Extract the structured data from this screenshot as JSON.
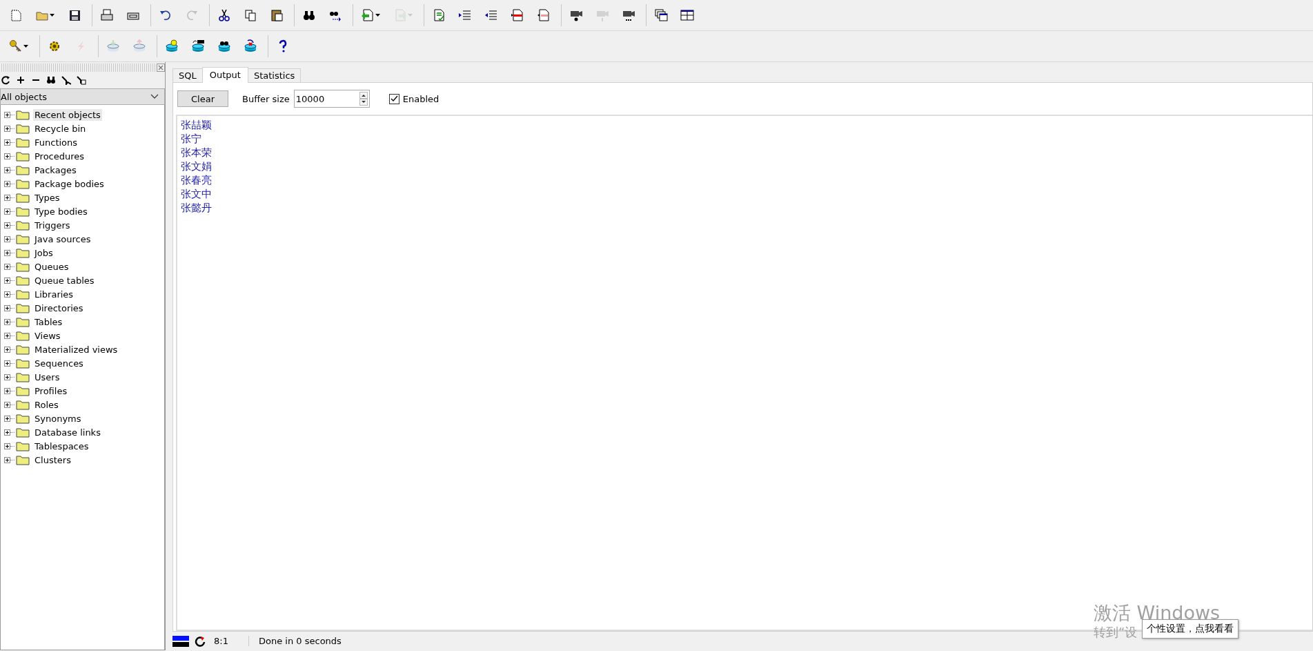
{
  "toolbars": [
    [
      [
        {
          "disabled": false,
          "dropdown": false
        },
        {
          "disabled": false,
          "dropdown": true
        },
        {
          "disabled": false,
          "dropdown": false
        }
      ],
      [
        {
          "disabled": false,
          "dropdown": false
        },
        {
          "disabled": false,
          "dropdown": false
        }
      ],
      [
        {
          "disabled": false,
          "dropdown": false
        },
        {
          "disabled": true,
          "dropdown": false
        }
      ],
      [
        {
          "disabled": false,
          "dropdown": false
        },
        {
          "disabled": false,
          "dropdown": false
        },
        {
          "disabled": false,
          "dropdown": false
        }
      ],
      [
        {
          "disabled": false,
          "dropdown": false
        },
        {
          "disabled": false,
          "dropdown": false
        }
      ],
      [
        {
          "disabled": false,
          "dropdown": true
        },
        {
          "disabled": true,
          "dropdown": true
        }
      ],
      [
        {
          "disabled": false,
          "dropdown": false
        },
        {
          "disabled": false,
          "dropdown": false
        },
        {
          "disabled": false,
          "dropdown": false
        },
        {
          "disabled": false,
          "dropdown": false
        },
        {
          "disabled": false,
          "dropdown": false
        }
      ],
      [
        {
          "disabled": false,
          "dropdown": false
        },
        {
          "disabled": true,
          "dropdown": false
        },
        {
          "disabled": false,
          "dropdown": false
        }
      ],
      [
        {
          "disabled": false,
          "dropdown": false
        },
        {
          "disabled": false,
          "dropdown": false
        }
      ]
    ],
    [
      [
        {
          "disabled": false,
          "dropdown": true
        }
      ],
      [
        {
          "disabled": false,
          "dropdown": false
        },
        {
          "disabled": true,
          "dropdown": false
        }
      ],
      [
        {
          "disabled": true,
          "dropdown": false
        },
        {
          "disabled": true,
          "dropdown": false
        }
      ],
      [
        {
          "disabled": false,
          "dropdown": false
        },
        {
          "disabled": false,
          "dropdown": false
        },
        {
          "disabled": false,
          "dropdown": false
        },
        {
          "disabled": false,
          "dropdown": false
        }
      ],
      [
        {
          "disabled": false,
          "dropdown": false
        }
      ]
    ]
  ],
  "browser": {
    "filter": "All objects",
    "items": [
      {
        "label": "Recent objects",
        "selected": true
      },
      {
        "label": "Recycle bin",
        "selected": false
      },
      {
        "label": "Functions",
        "selected": false
      },
      {
        "label": "Procedures",
        "selected": false
      },
      {
        "label": "Packages",
        "selected": false
      },
      {
        "label": "Package bodies",
        "selected": false
      },
      {
        "label": "Types",
        "selected": false
      },
      {
        "label": "Type bodies",
        "selected": false
      },
      {
        "label": "Triggers",
        "selected": false
      },
      {
        "label": "Java sources",
        "selected": false
      },
      {
        "label": "Jobs",
        "selected": false
      },
      {
        "label": "Queues",
        "selected": false
      },
      {
        "label": "Queue tables",
        "selected": false
      },
      {
        "label": "Libraries",
        "selected": false
      },
      {
        "label": "Directories",
        "selected": false
      },
      {
        "label": "Tables",
        "selected": false
      },
      {
        "label": "Views",
        "selected": false
      },
      {
        "label": "Materialized views",
        "selected": false
      },
      {
        "label": "Sequences",
        "selected": false
      },
      {
        "label": "Users",
        "selected": false
      },
      {
        "label": "Profiles",
        "selected": false
      },
      {
        "label": "Roles",
        "selected": false
      },
      {
        "label": "Synonyms",
        "selected": false
      },
      {
        "label": "Database links",
        "selected": false
      },
      {
        "label": "Tablespaces",
        "selected": false
      },
      {
        "label": "Clusters",
        "selected": false
      }
    ]
  },
  "tabs": [
    {
      "label": "SQL",
      "selected": false
    },
    {
      "label": "Output",
      "selected": true
    },
    {
      "label": "Statistics",
      "selected": false
    }
  ],
  "output": {
    "clear_button": "Clear",
    "buffer_label": "Buffer size",
    "buffer_value": "10000",
    "enabled": {
      "label": "Enabled",
      "checked": true
    },
    "lines": [
      "张喆颖",
      "张宁",
      "张本荣",
      "张文娟",
      "张春亮",
      "张文中",
      "张懿丹"
    ]
  },
  "status_bar": {
    "position": "8:1",
    "message": "Done in 0 seconds"
  },
  "activation": {
    "title": "激活 Windows",
    "subtitle": "转到“设"
  },
  "tooltip": "个性设置，点我看看"
}
